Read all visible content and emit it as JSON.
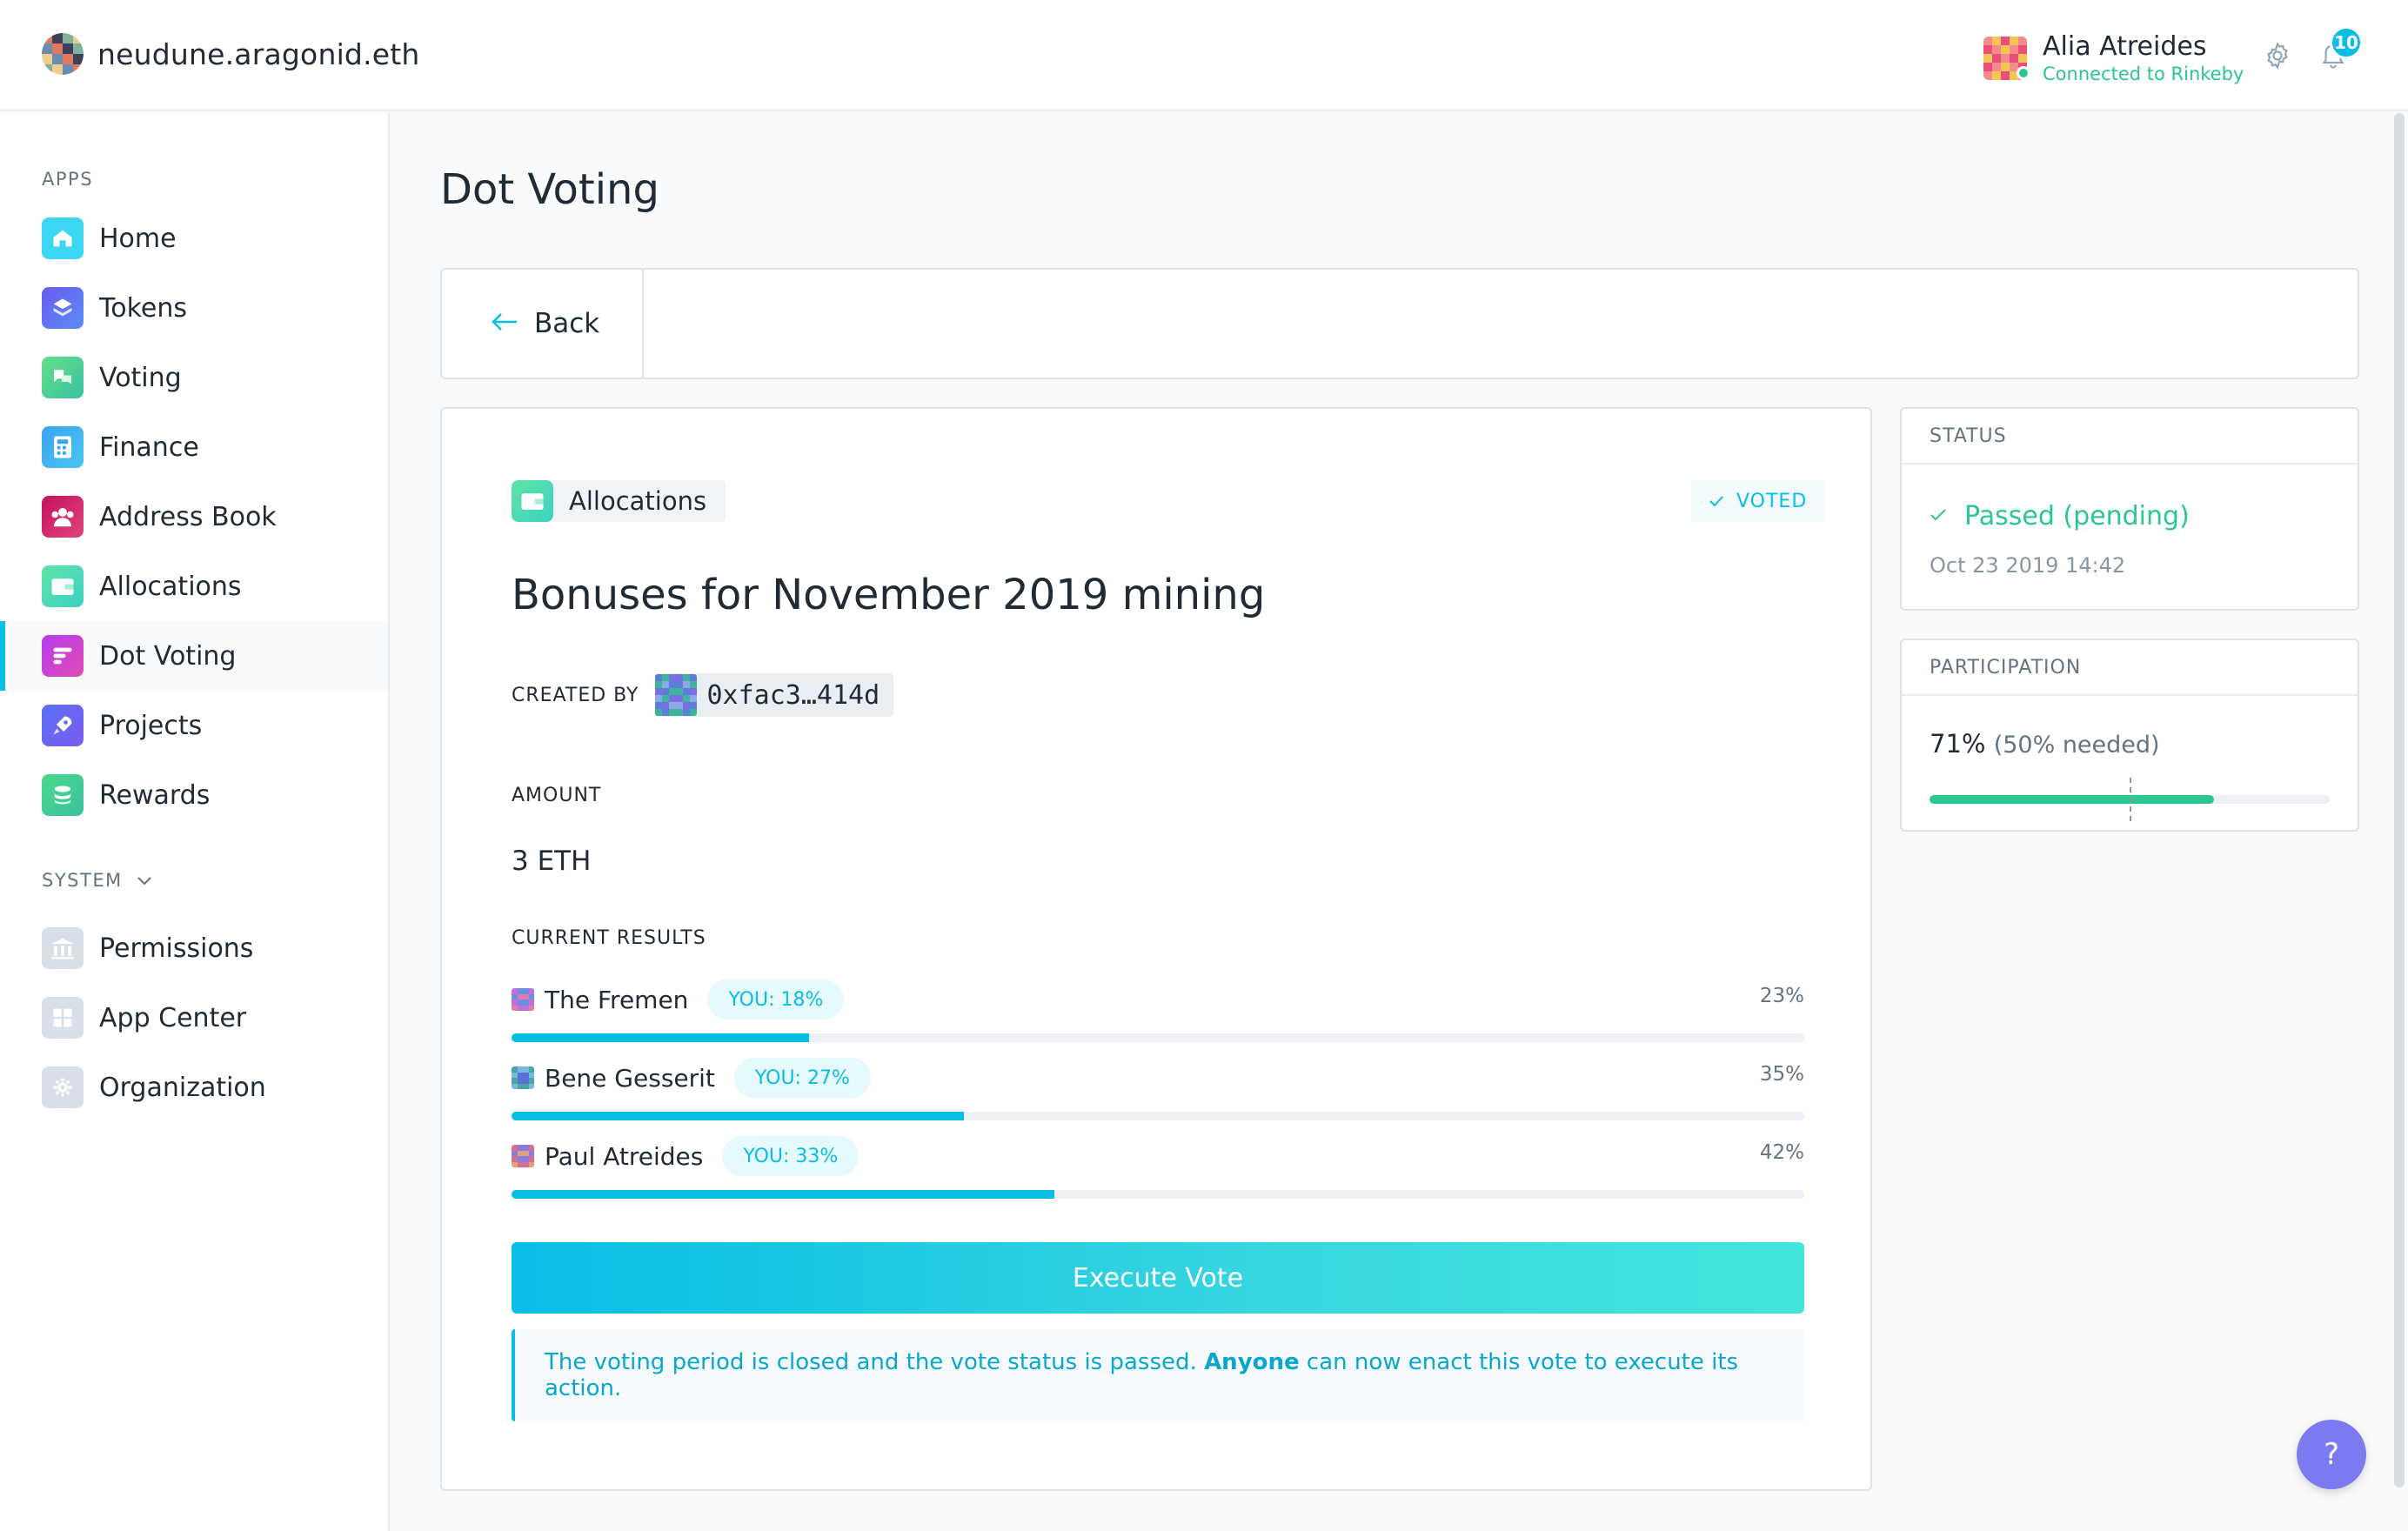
{
  "header": {
    "org_name": "neudune.aragonid.eth",
    "account_name": "Alia Atreides",
    "account_status": "Connected to Rinkeby",
    "notification_count": "10",
    "settings_icon": "gear-icon",
    "notifications_icon": "bell-icon"
  },
  "sidebar": {
    "apps_label": "APPS",
    "system_label": "SYSTEM",
    "apps": [
      {
        "label": "Home",
        "icon": "home-icon",
        "color": "#3dd6f5"
      },
      {
        "label": "Tokens",
        "icon": "tokens-icon",
        "color": "#6a5bf0"
      },
      {
        "label": "Voting",
        "icon": "voting-icon",
        "color": "#62e08a"
      },
      {
        "label": "Finance",
        "icon": "finance-icon",
        "color": "#3aa3f2"
      },
      {
        "label": "Address Book",
        "icon": "address-book-icon",
        "color": "#c3125f"
      },
      {
        "label": "Allocations",
        "icon": "allocations-icon",
        "color": "#5fe3a6"
      },
      {
        "label": "Dot Voting",
        "icon": "dot-voting-icon",
        "color": "#b53df0"
      },
      {
        "label": "Projects",
        "icon": "projects-icon",
        "color": "#5a6ff5"
      },
      {
        "label": "Rewards",
        "icon": "rewards-icon",
        "color": "#49d98a"
      }
    ],
    "system": [
      {
        "label": "Permissions",
        "icon": "permissions-icon"
      },
      {
        "label": "App Center",
        "icon": "app-center-icon"
      },
      {
        "label": "Organization",
        "icon": "organization-icon"
      }
    ],
    "active": "Dot Voting"
  },
  "main": {
    "page_title": "Dot Voting",
    "back_label": "Back",
    "app_tag": "Allocations",
    "voted_label": "VOTED",
    "vote_title": "Bonuses for November 2019 mining",
    "created_by_label": "CREATED BY",
    "creator_address": "0xfac3…414d",
    "amount_label": "AMOUNT",
    "amount_value": "3 ETH",
    "results_label": "CURRENT RESULTS",
    "results": [
      {
        "name": "The Fremen",
        "you": "YOU: 18%",
        "pct": "23%",
        "value": 23
      },
      {
        "name": "Bene Gesserit",
        "you": "YOU: 27%",
        "pct": "35%",
        "value": 35
      },
      {
        "name": "Paul Atreides",
        "you": "YOU: 33%",
        "pct": "42%",
        "value": 42
      }
    ],
    "execute_label": "Execute Vote",
    "info_before": "The voting period is closed and the vote status is passed. ",
    "info_bold": "Anyone",
    "info_after": " can now enact this vote to execute its action."
  },
  "status": {
    "header": "STATUS",
    "text": "Passed (pending)",
    "date": "Oct 23 2019 14:42"
  },
  "participation": {
    "header": "PARTICIPATION",
    "pct": "71%",
    "needed": "(50% needed)",
    "value": 71,
    "needed_value": 50
  },
  "help_label": "?",
  "colors": {
    "accent": "#08bee5",
    "positive": "#2cc68f",
    "help": "#7b7af0"
  }
}
